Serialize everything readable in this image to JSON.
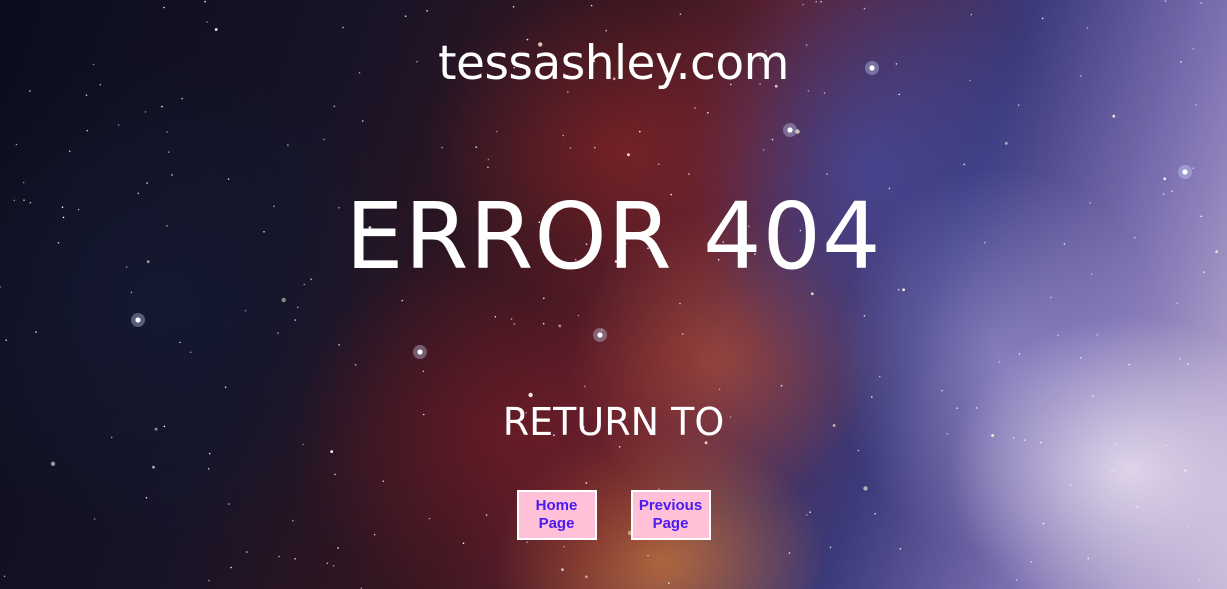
{
  "site": {
    "title": "tessashley.com"
  },
  "error": {
    "heading": "ERROR 404"
  },
  "return_section": {
    "label": "RETURN TO",
    "buttons": [
      {
        "label": "Home Page"
      },
      {
        "label": "Previous Page"
      }
    ]
  },
  "colors": {
    "button_bg": "#ffc0d8",
    "button_text": "#4a1cf0",
    "button_border": "#ffffff",
    "text": "#ffffff"
  }
}
